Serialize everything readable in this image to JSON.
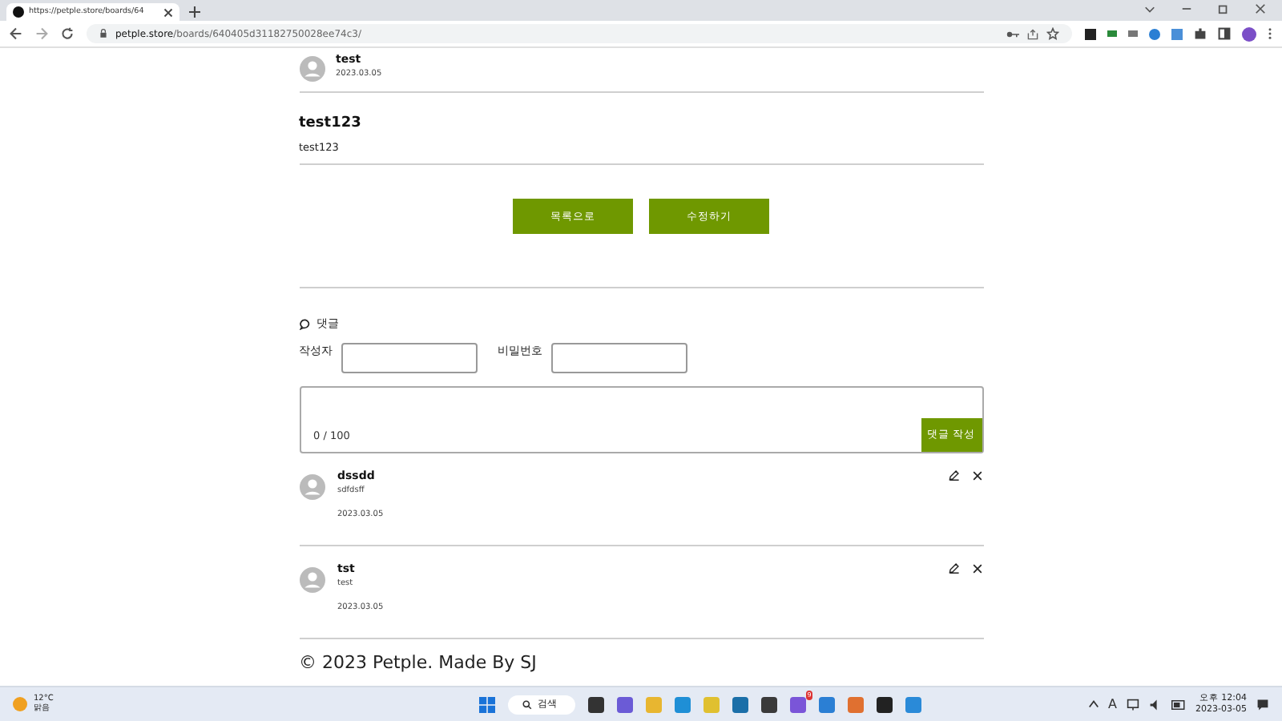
{
  "browser": {
    "tab_title": "https://petple.store/boards/64",
    "url_host": "petple.store",
    "url_path": "/boards/640405d31182750028ee74c3/"
  },
  "post": {
    "author": "test",
    "date": "2023.03.05",
    "title": "test123",
    "body": "test123"
  },
  "buttons": [
    "목록으로",
    "수정하기"
  ],
  "comments_section": {
    "heading": "댓글",
    "writer_label": "작성자",
    "password_label": "비밀번호",
    "counter": "0 / 100",
    "submit": "댓글 작성"
  },
  "comments": [
    {
      "author": "dssdd",
      "text": "sdfdsff",
      "date": "2023.03.05"
    },
    {
      "author": "tst",
      "text": "test",
      "date": "2023.03.05"
    }
  ],
  "footer": "© 2023 Petple. Made By SJ",
  "taskbar": {
    "temperature": "12°C",
    "weather": "맑음",
    "search": "검색",
    "badge": "9",
    "time": "오후 12:04",
    "date": "2023-03-05",
    "ime": "A"
  }
}
